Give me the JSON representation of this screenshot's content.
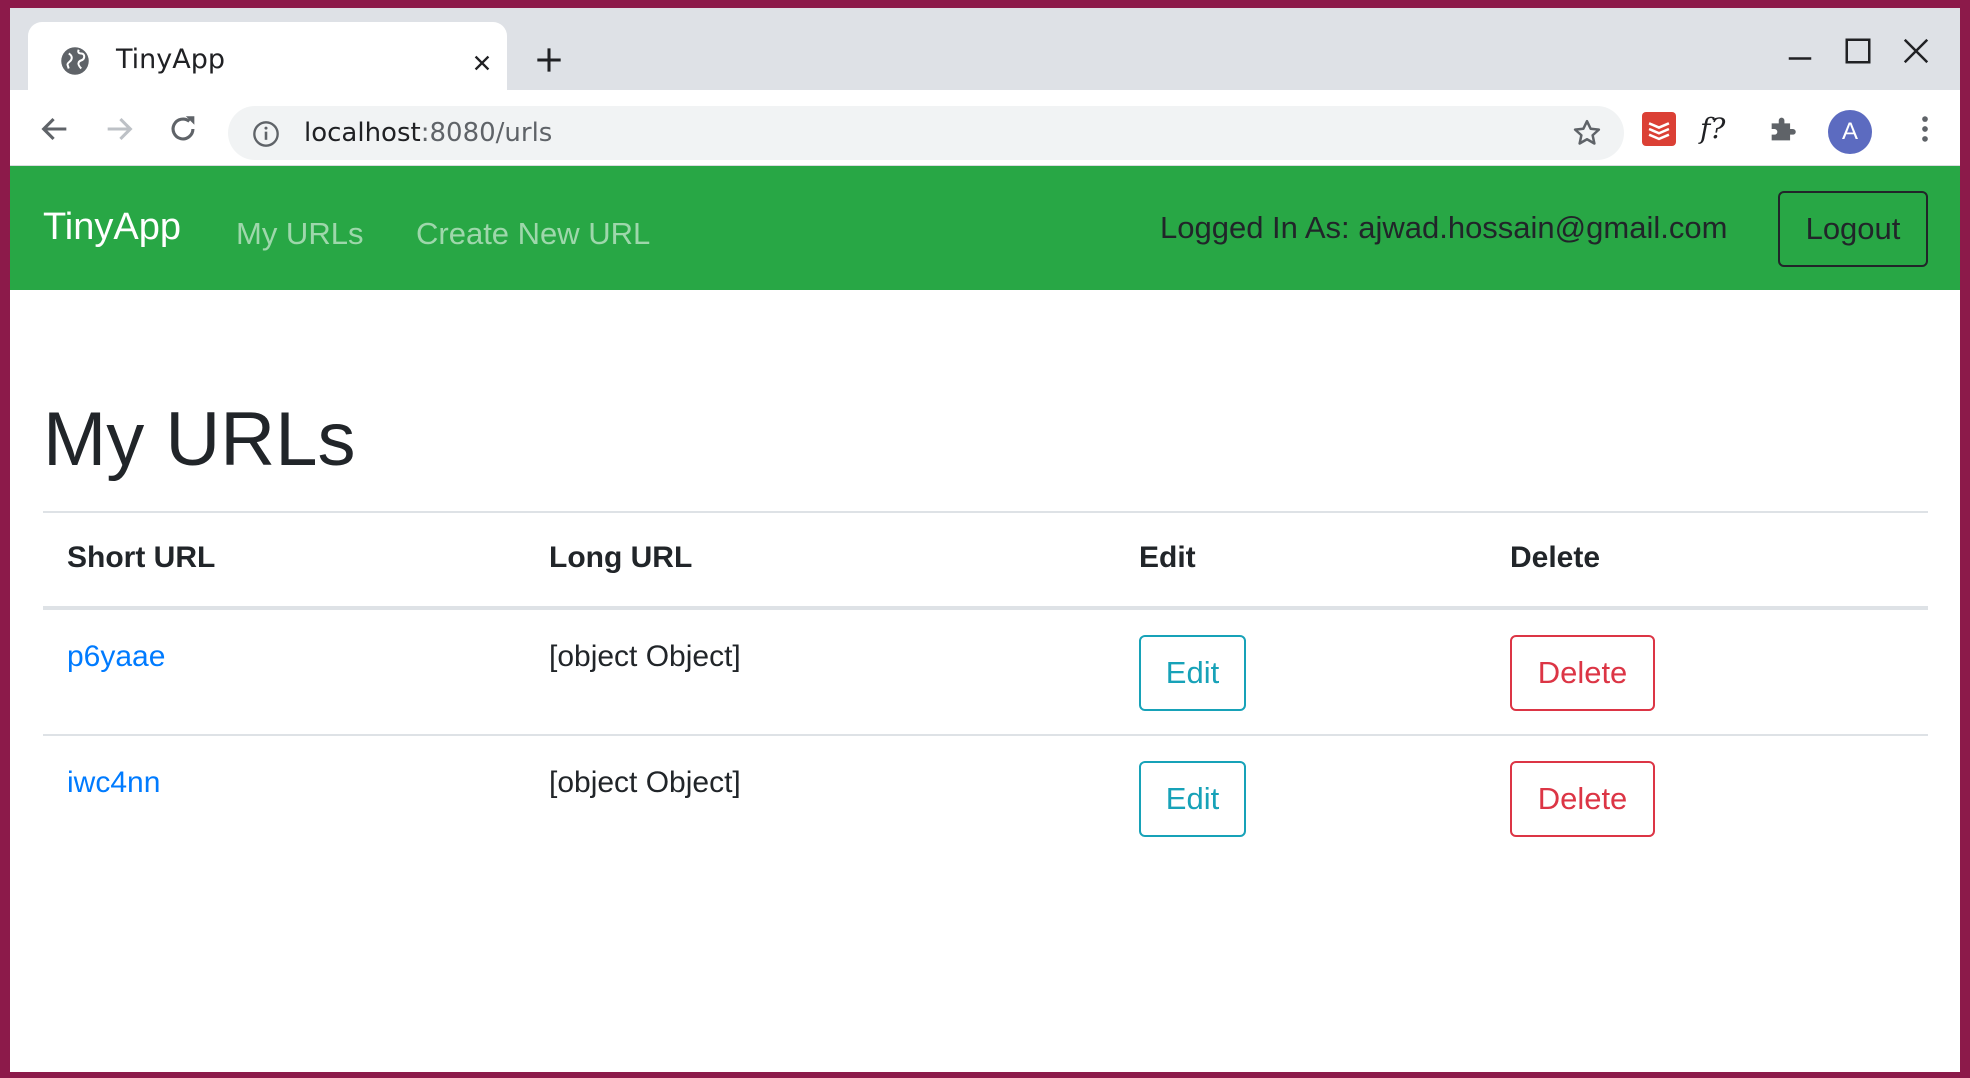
{
  "browser": {
    "tab_title": "TinyApp",
    "url_host": "localhost",
    "url_path": ":8080/urls",
    "avatar_letter": "A",
    "extension_f_label": "f?"
  },
  "navbar": {
    "brand": "TinyApp",
    "links": [
      "My URLs",
      "Create New URL"
    ],
    "logged_in_text": "Logged In As: ajwad.hossain@gmail.com",
    "logout_label": "Logout",
    "background": "#28a745"
  },
  "main": {
    "title": "My URLs",
    "columns": [
      "Short URL",
      "Long URL",
      "Edit",
      "Delete"
    ],
    "rows": [
      {
        "short": "p6yaae",
        "long": "[object Object]",
        "edit": "Edit",
        "delete": "Delete"
      },
      {
        "short": "iwc4nn",
        "long": "[object Object]",
        "edit": "Edit",
        "delete": "Delete"
      }
    ]
  },
  "colors": {
    "link": "#007bff",
    "edit": "#17a2b8",
    "delete": "#dc3545"
  }
}
